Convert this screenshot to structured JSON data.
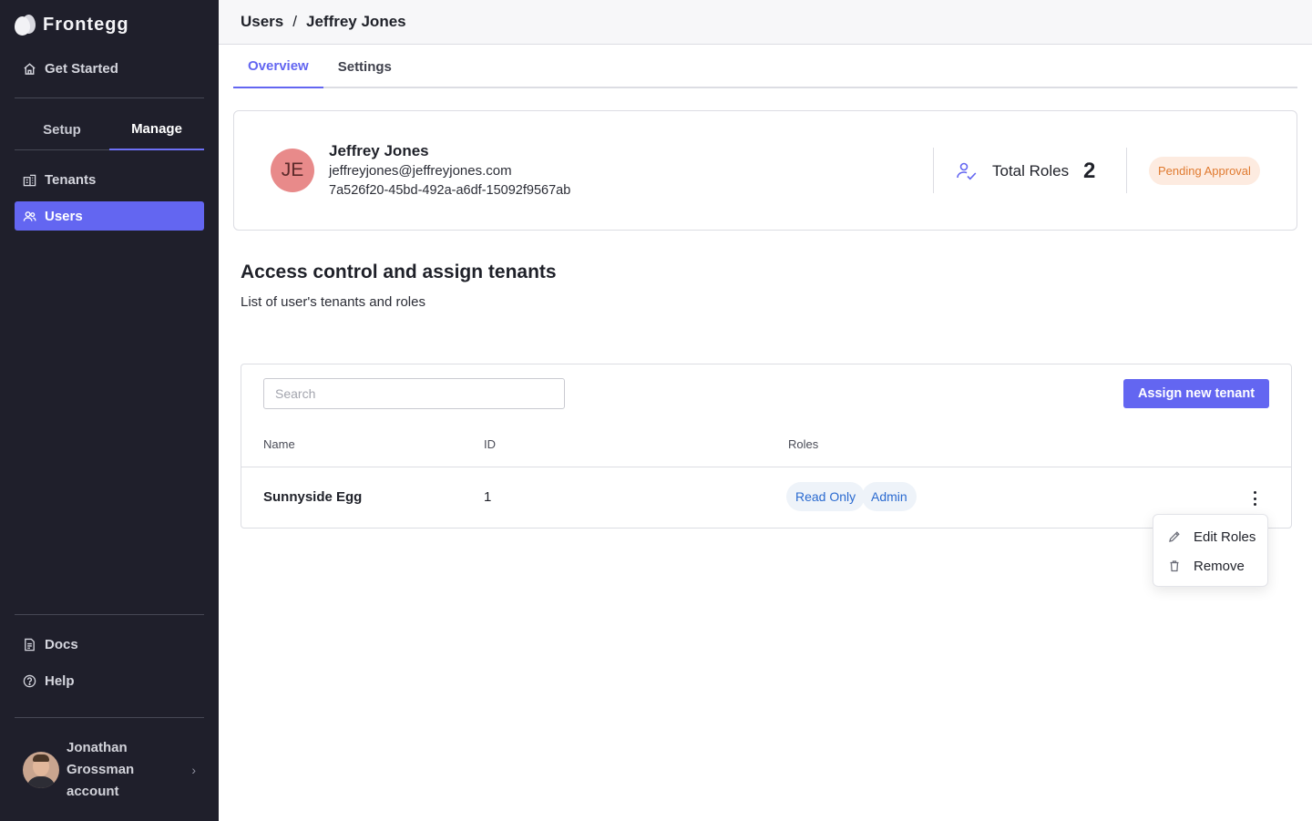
{
  "brand": {
    "name": "Frontegg"
  },
  "sidebar": {
    "get_started": "Get Started",
    "segments": {
      "setup": "Setup",
      "manage": "Manage",
      "active": "Manage"
    },
    "items": [
      {
        "label": "Tenants",
        "icon": "building-icon",
        "active": false
      },
      {
        "label": "Users",
        "icon": "users-icon",
        "active": true
      }
    ],
    "bottom": [
      {
        "label": "Docs",
        "icon": "document-icon"
      },
      {
        "label": "Help",
        "icon": "help-circle-icon"
      }
    ],
    "account": {
      "name": "Jonathan Grossman account"
    }
  },
  "breadcrumb": {
    "parent": "Users",
    "separator": "/",
    "current": "Jeffrey Jones"
  },
  "tabs": [
    {
      "label": "Overview",
      "active": true
    },
    {
      "label": "Settings",
      "active": false
    }
  ],
  "user": {
    "initials": "JE",
    "name": "Jeffrey Jones",
    "email": "jeffreyjones@jeffreyjones.com",
    "id": "7a526f20-45bd-492a-a6df-15092f9567ab",
    "total_roles_label": "Total Roles",
    "total_roles": "2",
    "status": "Pending Approval"
  },
  "section": {
    "title": "Access control and assign tenants",
    "subtitle": "List of user's tenants and roles"
  },
  "table": {
    "search_placeholder": "Search",
    "assign_button": "Assign new tenant",
    "columns": {
      "name": "Name",
      "id": "ID",
      "roles": "Roles"
    },
    "rows": [
      {
        "name": "Sunnyside Egg",
        "id": "1",
        "roles": [
          "Read Only",
          "Admin"
        ]
      }
    ]
  },
  "row_menu": {
    "items": [
      {
        "label": "Edit Roles",
        "icon": "pencil-icon"
      },
      {
        "label": "Remove",
        "icon": "trash-icon"
      }
    ]
  },
  "colors": {
    "accent": "#6366f1",
    "sidebar_bg": "#1f1f2b",
    "pending_bg": "#fdebe0",
    "pending_text": "#e07a2f",
    "chip_bg": "#eef3f9",
    "chip_text": "#2a6ad0",
    "avatar_bg": "#e88a8a"
  }
}
